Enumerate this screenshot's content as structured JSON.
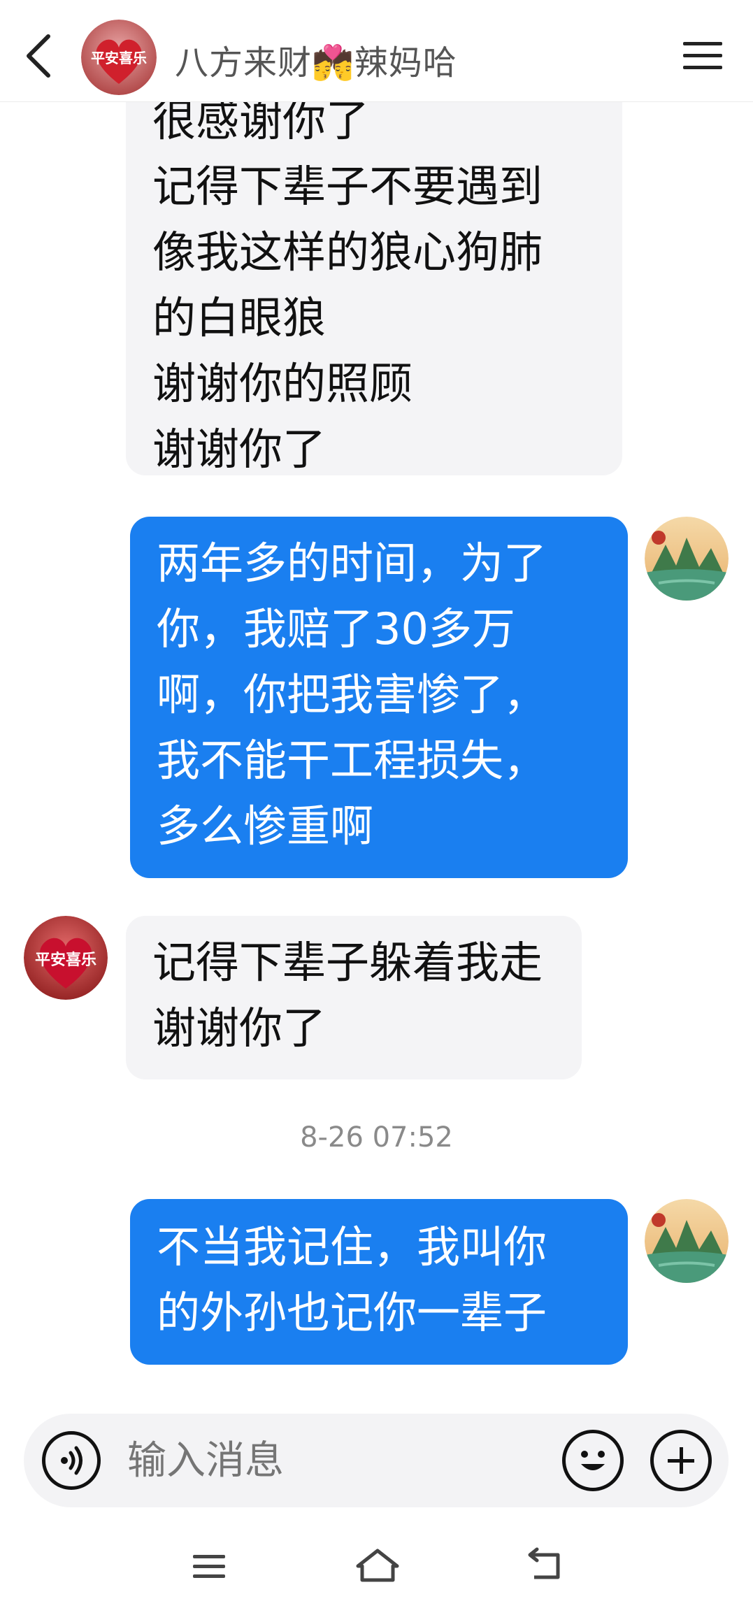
{
  "header": {
    "title": "八方来财💏辣妈哈",
    "avatar_text": "平安喜乐"
  },
  "messages": [
    {
      "side": "incoming",
      "lines": [
        "很感谢你了",
        "记得下辈子不要遇到",
        "像我这样的狼心狗肺",
        "的白眼狼",
        "谢谢你的照顾",
        "谢谢你了"
      ]
    },
    {
      "side": "outgoing",
      "lines": [
        "两年多的时间，为了",
        "你，我赔了30多万",
        "啊，你把我害惨了，",
        "我不能干工程损失，",
        "多么惨重啊"
      ]
    },
    {
      "side": "incoming",
      "lines": [
        "记得下辈子躲着我走",
        "谢谢你了"
      ]
    },
    {
      "side": "outgoing",
      "lines": [
        "不当我记住，我叫你",
        "的外孙也记你一辈子"
      ]
    }
  ],
  "timestamp": "8-26 07:52",
  "contact_avatar_text": "平安喜乐",
  "input": {
    "placeholder": "输入消息"
  },
  "icons": {
    "back": "chevron-left-icon",
    "menu": "hamburger-menu-icon",
    "voice": "voice-icon",
    "emoji": "emoji-icon",
    "plus": "plus-icon",
    "nav_menu": "recent-apps-icon",
    "nav_home": "home-icon",
    "nav_back": "back-icon"
  },
  "colors": {
    "outgoing_bubble": "#1a7ff0",
    "incoming_bubble": "#f4f4f6",
    "avatar_red": "#c8102e"
  }
}
